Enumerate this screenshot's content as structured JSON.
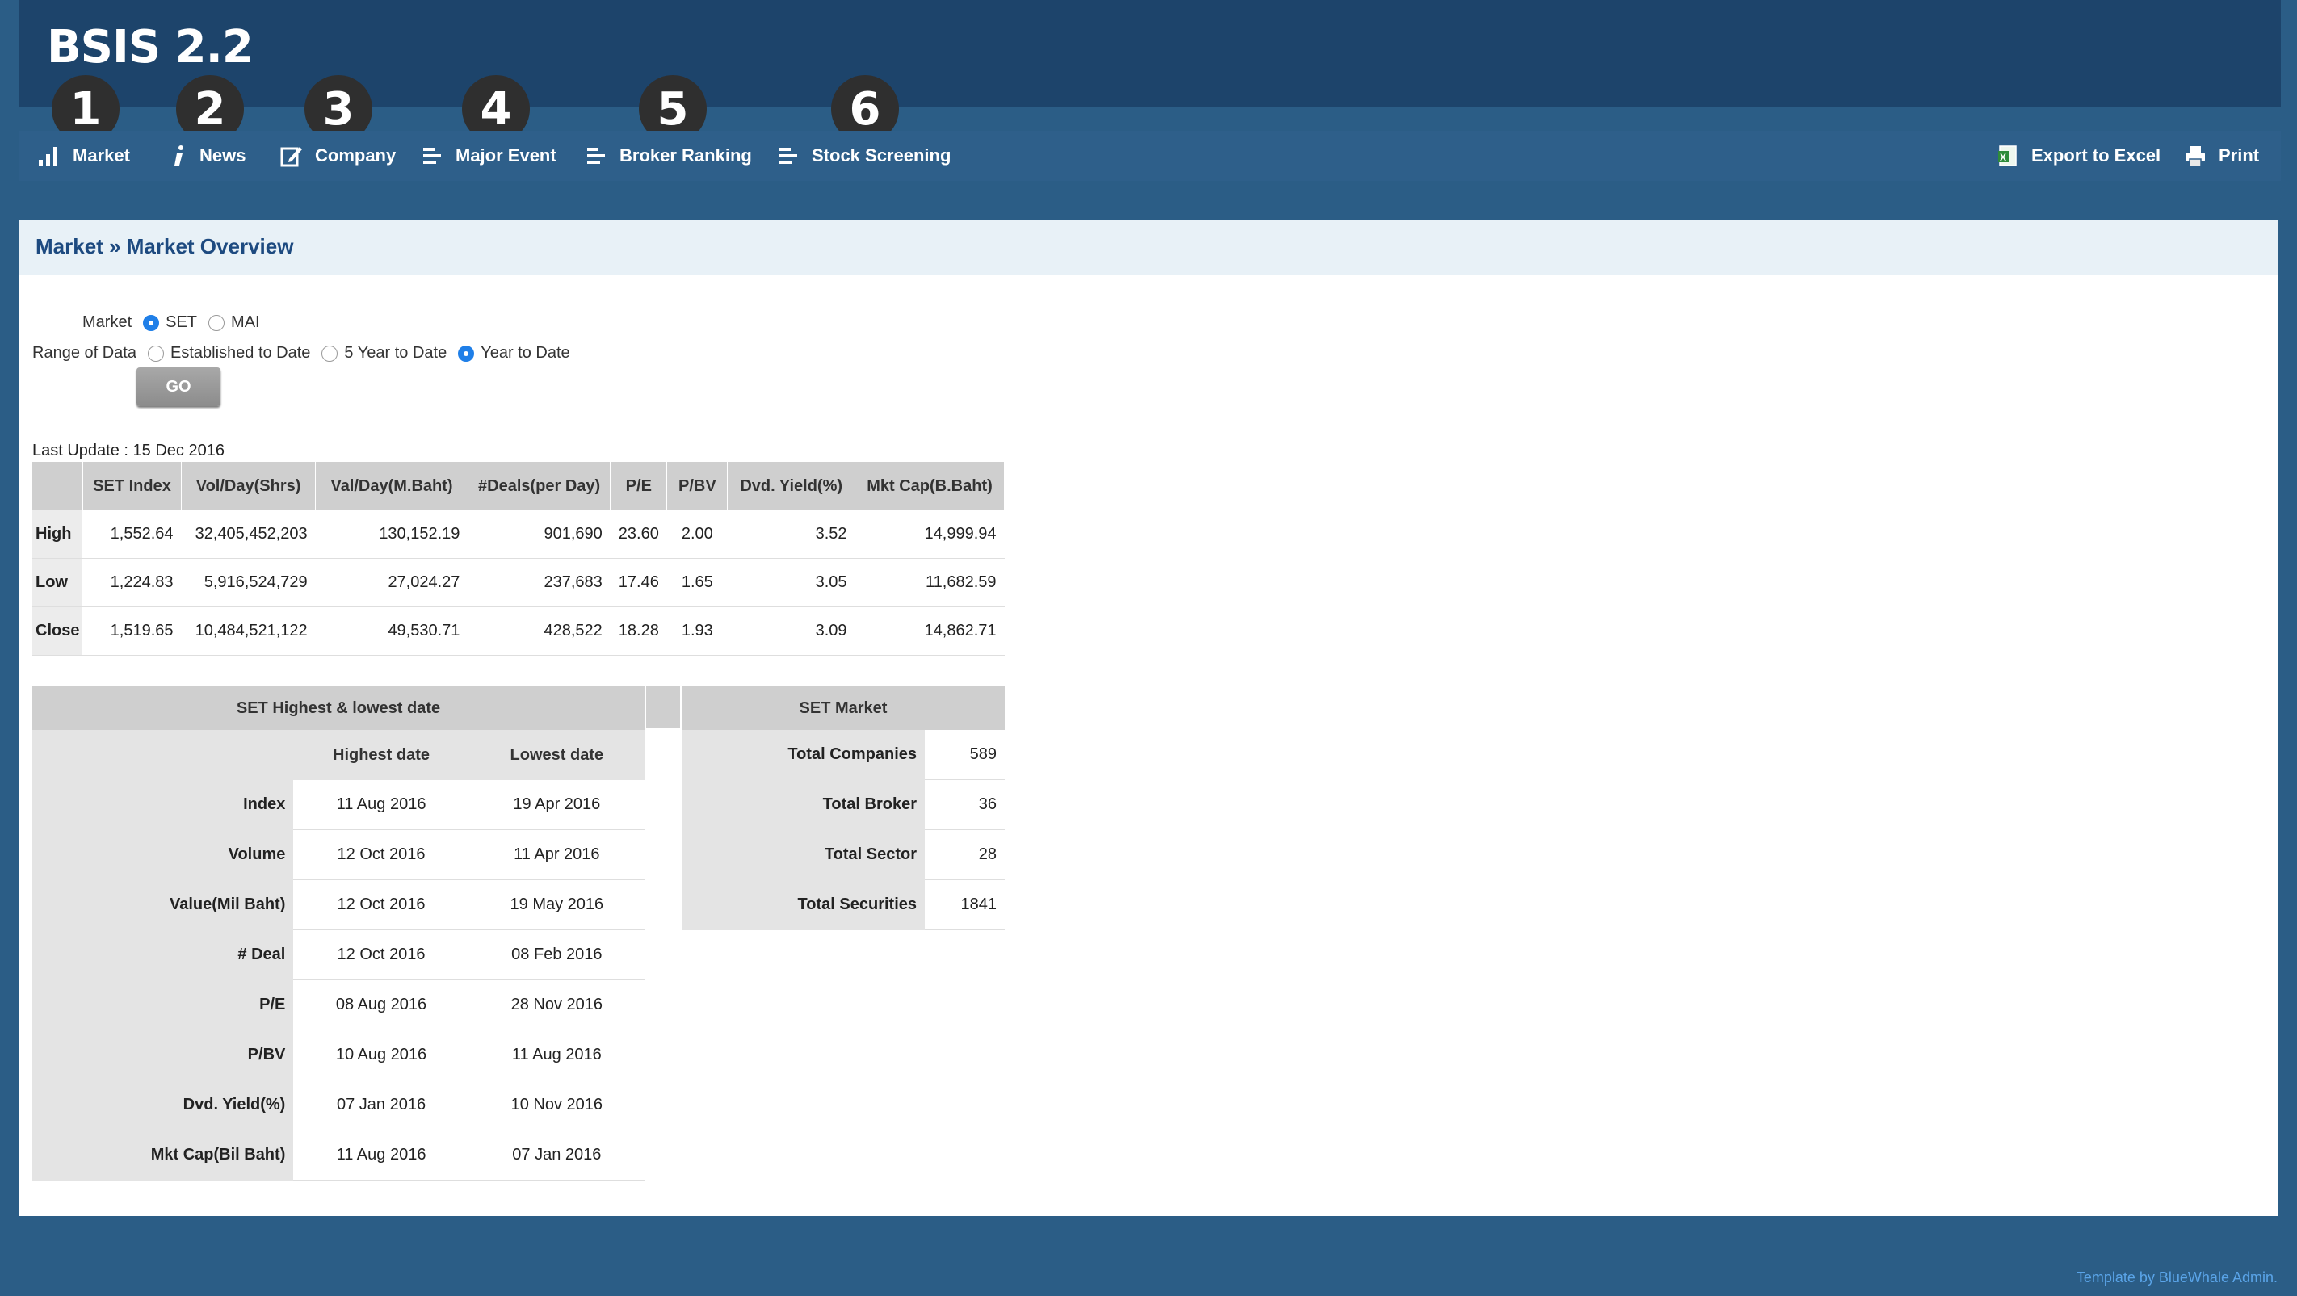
{
  "app": {
    "title": "BSIS 2.2"
  },
  "nav": {
    "items": [
      {
        "label": "Market",
        "badge": "1",
        "icon": "bar-chart-icon"
      },
      {
        "label": "News",
        "badge": "2",
        "icon": "info-icon"
      },
      {
        "label": "Company",
        "badge": "3",
        "icon": "edit-icon"
      },
      {
        "label": "Major Event",
        "badge": "4",
        "icon": "list-icon"
      },
      {
        "label": "Broker Ranking",
        "badge": "5",
        "icon": "list-icon"
      },
      {
        "label": "Stock Screening",
        "badge": "6",
        "icon": "list-icon"
      }
    ],
    "export_label": "Export to Excel",
    "print_label": "Print"
  },
  "breadcrumb": {
    "section": "Market",
    "separator": "»",
    "page": "Market Overview"
  },
  "filters": {
    "market_label": "Market",
    "market_options": [
      "SET",
      "MAI"
    ],
    "market_selected": "SET",
    "range_label": "Range of Data",
    "range_options": [
      "Established to Date",
      "5 Year to Date",
      "Year to Date"
    ],
    "range_selected": "Year to Date",
    "go_label": "GO"
  },
  "last_update": "Last Update : 15 Dec 2016",
  "summary_table": {
    "headers": [
      "",
      "SET Index",
      "Vol/Day(Shrs)",
      "Val/Day(M.Baht)",
      "#Deals(per Day)",
      "P/E",
      "P/BV",
      "Dvd. Yield(%)",
      "Mkt Cap(B.Baht)"
    ],
    "rows": [
      [
        "High",
        "1,552.64",
        "32,405,452,203",
        "130,152.19",
        "901,690",
        "23.60",
        "2.00",
        "3.52",
        "14,999.94"
      ],
      [
        "Low",
        "1,224.83",
        "5,916,524,729",
        "27,024.27",
        "237,683",
        "17.46",
        "1.65",
        "3.05",
        "11,682.59"
      ],
      [
        "Close",
        "1,519.65",
        "10,484,521,122",
        "49,530.71",
        "428,522",
        "18.28",
        "1.93",
        "3.09",
        "14,862.71"
      ]
    ]
  },
  "dates_table": {
    "title": "SET Highest & lowest date",
    "col_high": "Highest date",
    "col_low": "Lowest date",
    "rows": [
      [
        "Index",
        "11 Aug 2016",
        "19 Apr 2016"
      ],
      [
        "Volume",
        "12 Oct 2016",
        "11 Apr 2016"
      ],
      [
        "Value(Mil Baht)",
        "12 Oct 2016",
        "19 May 2016"
      ],
      [
        "# Deal",
        "12 Oct 2016",
        "08 Feb 2016"
      ],
      [
        "P/E",
        "08 Aug 2016",
        "28 Nov 2016"
      ],
      [
        "P/BV",
        "10 Aug 2016",
        "11 Aug 2016"
      ],
      [
        "Dvd. Yield(%)",
        "07 Jan 2016",
        "10 Nov 2016"
      ],
      [
        "Mkt Cap(Bil Baht)",
        "11 Aug 2016",
        "07 Jan 2016"
      ]
    ]
  },
  "market_table": {
    "title": "SET Market",
    "rows": [
      [
        "Total Companies",
        "589"
      ],
      [
        "Total Broker",
        "36"
      ],
      [
        "Total Sector",
        "28"
      ],
      [
        "Total Securities",
        "1841"
      ]
    ]
  },
  "footer": {
    "credit": "Template by BlueWhale Admin."
  }
}
